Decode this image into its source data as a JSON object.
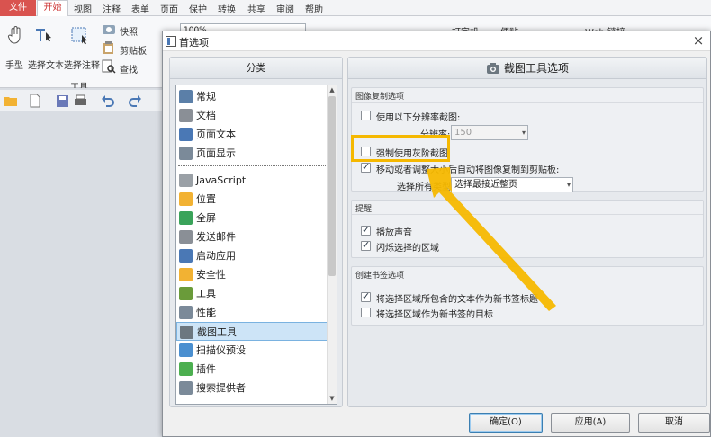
{
  "ribbon": {
    "tabs": [
      "文件",
      "开始",
      "视图",
      "注释",
      "表单",
      "页面",
      "保护",
      "转换",
      "共享",
      "审阅",
      "帮助"
    ],
    "active_tab": "开始",
    "tools": {
      "hand": "手型",
      "select_text": "选择文本",
      "select_annotation": "选择注释",
      "snapshot": "快照",
      "clipboard": "剪贴板",
      "find": "查找",
      "group_label": "工具",
      "zoom": "100%",
      "typewriter": "打字机",
      "sticky": "便贴",
      "weblink": "Web 链接"
    }
  },
  "dialog": {
    "title": "首选项",
    "close_glyph": "×",
    "category_header": "分类",
    "categories": [
      {
        "label": "常规",
        "icon": "general-icon",
        "color": "#5b7fa8"
      },
      {
        "label": "文档",
        "icon": "document-icon",
        "color": "#8a8f96"
      },
      {
        "label": "页面文本",
        "icon": "page-text-icon",
        "color": "#4a78b5"
      },
      {
        "label": "页面显示",
        "icon": "page-display-icon",
        "color": "#7b8a99"
      },
      {
        "label": "JavaScript",
        "icon": "javascript-icon",
        "color": "#9aa0a6"
      },
      {
        "label": "位置",
        "icon": "location-icon",
        "color": "#f2b233"
      },
      {
        "label": "全屏",
        "icon": "fullscreen-icon",
        "color": "#3aa35a"
      },
      {
        "label": "发送邮件",
        "icon": "email-icon",
        "color": "#8a8f96"
      },
      {
        "label": "启动应用",
        "icon": "launch-app-icon",
        "color": "#4a78b5"
      },
      {
        "label": "安全性",
        "icon": "shield-icon",
        "color": "#f2b233"
      },
      {
        "label": "工具",
        "icon": "tools-icon",
        "color": "#6a9b3a"
      },
      {
        "label": "性能",
        "icon": "performance-icon",
        "color": "#7b8a99"
      },
      {
        "label": "截图工具",
        "icon": "camera-icon",
        "color": "#6c7780"
      },
      {
        "label": "扫描仪预设",
        "icon": "scanner-icon",
        "color": "#4a8fd0"
      },
      {
        "label": "插件",
        "icon": "plugin-icon",
        "color": "#4caf50"
      },
      {
        "label": "搜索提供者",
        "icon": "search-provider-icon",
        "color": "#7b8a99"
      }
    ],
    "selected_category": "截图工具",
    "options_header": "截图工具选项",
    "copy_group": {
      "title": "图像复制选项",
      "use_resolution_label": "使用以下分辨率截图:",
      "use_resolution_checked": false,
      "resolution_label": "分辨率:",
      "resolution_value": "150",
      "grayscale_label": "强制使用灰阶截图",
      "grayscale_checked": false,
      "move_copy_label": "移动或者调整大小后自动将图像复制到剪贴板:",
      "move_copy_checked": true,
      "select_type_label": "选择所有类型:",
      "select_type_value": "选择最接近整页"
    },
    "reminder_group": {
      "title": "提醒",
      "play_sound_label": "播放声音",
      "play_sound_checked": true,
      "flash_label": "闪烁选择的区域",
      "flash_checked": true
    },
    "bookmark_group": {
      "title": "创建书签选项",
      "text_as_title_label": "将选择区域所包含的文本作为新书签标题",
      "text_as_title_checked": true,
      "as_target_label": "将选择区域作为新书签的目标",
      "as_target_checked": false
    },
    "buttons": {
      "ok": "确定(O)",
      "apply": "应用(A)",
      "cancel": "取消"
    }
  },
  "annotation": {
    "highlight_color": "#f5b800"
  }
}
